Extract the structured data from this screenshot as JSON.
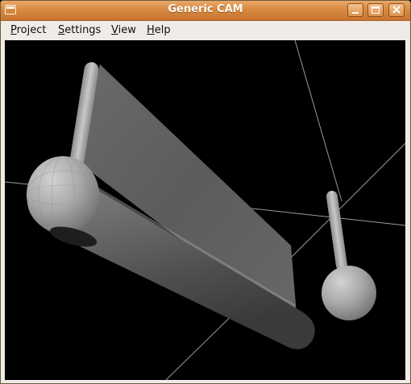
{
  "window": {
    "title": "Generic CAM"
  },
  "menubar": {
    "items": [
      {
        "mnemonic": "P",
        "rest": "roject"
      },
      {
        "mnemonic": "S",
        "rest": "ettings"
      },
      {
        "mnemonic": "V",
        "rest": "iew"
      },
      {
        "mnemonic": "H",
        "rest": "elp"
      }
    ]
  },
  "icons": {
    "window_menu": "window-menu-icon",
    "minimize": "minimize-icon",
    "maximize": "maximize-icon",
    "close": "close-icon"
  },
  "colors": {
    "titlebar": "#d88a43",
    "viewport_background": "#000000",
    "model_gray": "#808080"
  }
}
